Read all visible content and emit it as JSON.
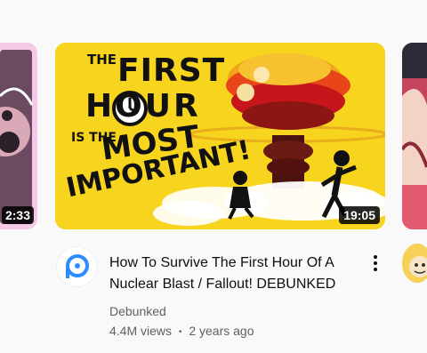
{
  "cards": {
    "left": {
      "duration": "2:33"
    },
    "main": {
      "duration": "19:05",
      "thumbnail_text": {
        "line1": "THE",
        "line2": "FIRST",
        "line3": "HOUR",
        "line4": "IS THE",
        "line5": "MOST",
        "line6": "IMPORTANT!"
      },
      "title_line1": "How To Survive The First Hour Of A",
      "title_line2": "Nuclear Blast / Fallout! DEBUNKED",
      "channel": "Debunked",
      "views": "4.4M views",
      "age": "2 years ago",
      "separator": "•",
      "menu_icon": "more-vert-icon"
    }
  },
  "colors": {
    "background": "#f9f9f9",
    "thumb_yellow": "#f7d51f",
    "text_primary": "#0f0f0f",
    "text_secondary": "#606060",
    "channel_brand": "#2d8cff"
  }
}
